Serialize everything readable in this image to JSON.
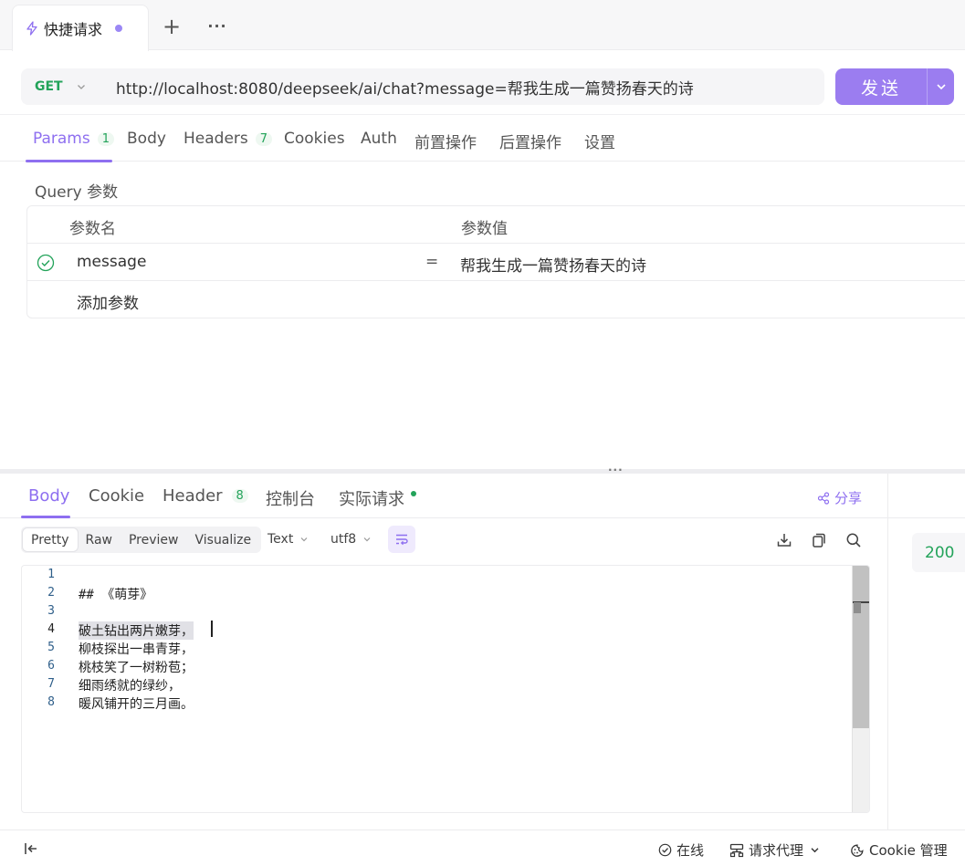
{
  "tabs": {
    "active_title": "快捷请求",
    "add_label": "+",
    "more_label": "···"
  },
  "request": {
    "method": "GET",
    "url": "http://localhost:8080/deepseek/ai/chat?message=帮我生成一篇赞扬春天的诗",
    "send_label": "发送"
  },
  "request_tabs": [
    {
      "label": "Params",
      "count": "1"
    },
    {
      "label": "Body"
    },
    {
      "label": "Headers",
      "count": "7"
    },
    {
      "label": "Cookies"
    },
    {
      "label": "Auth"
    },
    {
      "label": "前置操作"
    },
    {
      "label": "后置操作"
    },
    {
      "label": "设置"
    }
  ],
  "query": {
    "title": "Query 参数",
    "col_name": "参数名",
    "col_value": "参数值",
    "rows": [
      {
        "name": "message",
        "eq": "=",
        "value": "帮我生成一篇赞扬春天的诗"
      }
    ],
    "add_placeholder": "添加参数"
  },
  "splitter_label": "···",
  "response": {
    "tabs": [
      {
        "label": "Body"
      },
      {
        "label": "Cookie"
      },
      {
        "label": "Header",
        "count": "8"
      },
      {
        "label": "控制台"
      },
      {
        "label": "实际请求"
      }
    ],
    "share_label": "分享",
    "views": [
      "Pretty",
      "Raw",
      "Preview",
      "Visualize"
    ],
    "format": "Text",
    "encoding": "utf8",
    "status_code": "200",
    "lines": [
      {
        "num": "1",
        "text": ""
      },
      {
        "num": "2",
        "text": "## 《萌芽》"
      },
      {
        "num": "3",
        "text": ""
      },
      {
        "num": "4",
        "text": "破土钻出两片嫩芽，"
      },
      {
        "num": "5",
        "text": "柳枝探出一串青芽，"
      },
      {
        "num": "6",
        "text": "桃枝笑了一树粉苞；"
      },
      {
        "num": "7",
        "text": "细雨绣就的绿纱，"
      },
      {
        "num": "8",
        "text": "暖风铺开的三月画。"
      }
    ]
  },
  "footer": {
    "online_label": "在线",
    "proxy_label": "请求代理",
    "cookie_label": "Cookie 管理"
  },
  "colors": {
    "accent": "#8e6ff0",
    "send": "#9b7df0",
    "success": "#23a35a"
  }
}
